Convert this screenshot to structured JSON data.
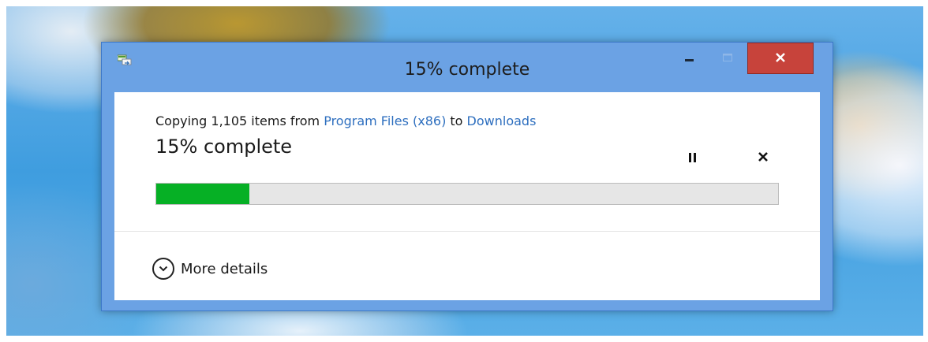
{
  "window": {
    "title": "15% complete",
    "icon": "copy-files-icon",
    "controls": {
      "minimize_icon": "minimize-icon",
      "maximize_icon": "maximize-icon",
      "close_icon": "close-icon"
    }
  },
  "dialog": {
    "copy_prefix": "Copying 1,105 items from ",
    "source": "Program Files (x86)",
    "to_word": " to ",
    "destination": "Downloads",
    "percent_text": "15% complete",
    "progress": 0.15,
    "pause_icon": "pause-icon",
    "cancel_icon": "cancel-icon",
    "more_details_label": "More details",
    "more_details_icon": "chevron-down-circle-icon"
  },
  "colors": {
    "titlebar": "#6ba2e4",
    "close_button": "#c7433b",
    "progress_fill": "#06b025",
    "link": "#2e6fbf"
  }
}
